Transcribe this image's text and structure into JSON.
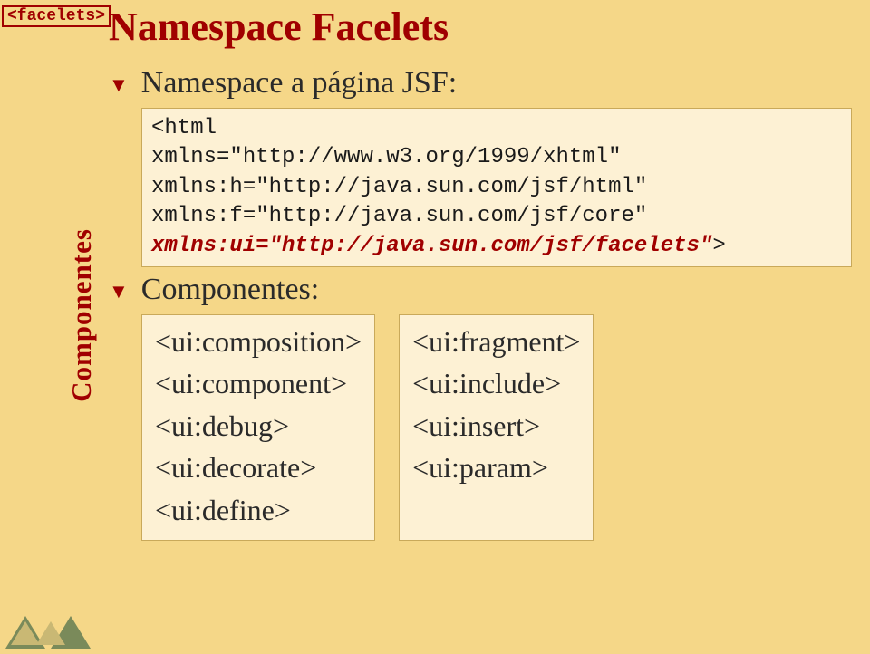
{
  "badge": "<facelets>",
  "sidebar": "Componentes",
  "title": "Namespace Facelets",
  "bullet1": "Namespace a página JSF:",
  "code": {
    "line1": "<html",
    "line2": "xmlns=\"http://www.w3.org/1999/xhtml\"",
    "line3": "xmlns:h=\"http://java.sun.com/jsf/html\"",
    "line4": "xmlns:f=\"http://java.sun.com/jsf/core\"",
    "line5_plain": "xmlns:ui=\"http://java.sun.com/jsf/facelets\"",
    "line5_suffix": ">"
  },
  "bullet2": "Componentes:",
  "components_left": [
    "<ui:composition>",
    "<ui:component>",
    "<ui:debug>",
    "<ui:decorate>",
    "<ui:define>"
  ],
  "components_right": [
    "<ui:fragment>",
    "<ui:include>",
    "<ui:insert>",
    "<ui:param>"
  ]
}
